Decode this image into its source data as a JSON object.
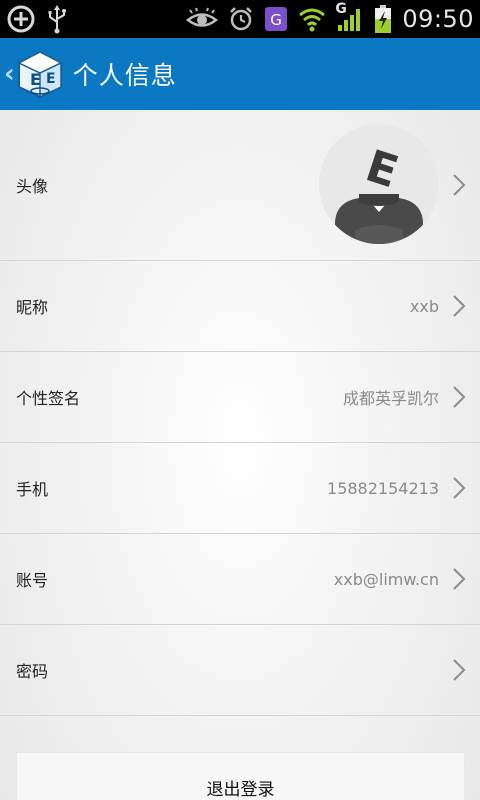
{
  "status_bar": {
    "time": "09:50",
    "network_type": "G",
    "icons": [
      "add-circle-icon",
      "usb-icon",
      "eye-icon",
      "alarm-icon",
      "g-app-icon",
      "wifi-icon",
      "signal-icon",
      "battery-icon"
    ]
  },
  "header": {
    "back_glyph": "‹",
    "logo_letters": "EE",
    "title": "个人信息"
  },
  "rows": [
    {
      "id": "avatar",
      "label": "头像",
      "value": ""
    },
    {
      "id": "nickname",
      "label": "昵称",
      "value": "xxb"
    },
    {
      "id": "signature",
      "label": "个性签名",
      "value": "成都英孚凯尔"
    },
    {
      "id": "phone",
      "label": "手机",
      "value": "15882154213"
    },
    {
      "id": "account",
      "label": "账号",
      "value": "xxb@limw.cn"
    },
    {
      "id": "password",
      "label": "密码",
      "value": ""
    }
  ],
  "avatar_letter": "E",
  "logout_label": "退出登录",
  "colors": {
    "header_bg": "#0a78c2",
    "status_bg": "#000000",
    "value_text": "#8a8a8a"
  }
}
